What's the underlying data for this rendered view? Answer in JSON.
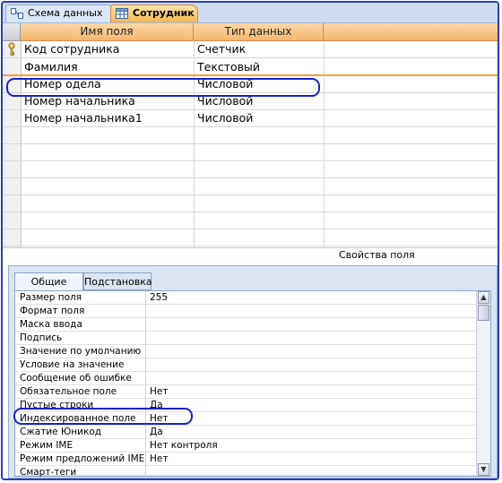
{
  "tabs": [
    {
      "label": "Схема данных",
      "icon": "relationships-icon"
    },
    {
      "label": "Сотрудник",
      "icon": "table-icon",
      "active": true
    }
  ],
  "grid": {
    "columns": [
      "Имя поля",
      "Тип данных",
      ""
    ],
    "rows": [
      {
        "name": "Код сотрудника",
        "type": "Счетчик",
        "key": true
      },
      {
        "name": "Фамилия",
        "type": "Текстовый",
        "current": true
      },
      {
        "name": "Номер одела",
        "type": "Числовой"
      },
      {
        "name": "Номер начальника",
        "type": "Числовой"
      },
      {
        "name": "Номер начальника1",
        "type": "Числовой"
      }
    ]
  },
  "properties_title": "Свойства поля",
  "property_tabs": [
    "Общие",
    "Подстановка"
  ],
  "properties": [
    {
      "label": "Размер поля",
      "value": "255"
    },
    {
      "label": "Формат поля",
      "value": ""
    },
    {
      "label": "Маска ввода",
      "value": ""
    },
    {
      "label": "Подпись",
      "value": ""
    },
    {
      "label": "Значение по умолчанию",
      "value": ""
    },
    {
      "label": "Условие на значение",
      "value": ""
    },
    {
      "label": "Сообщение об ошибке",
      "value": ""
    },
    {
      "label": "Обязательное поле",
      "value": "Нет"
    },
    {
      "label": "Пустые строки",
      "value": "Да"
    },
    {
      "label": "Индексированное поле",
      "value": "Нет"
    },
    {
      "label": "Сжатие Юникод",
      "value": "Да"
    },
    {
      "label": "Режим IME",
      "value": "Нет контроля"
    },
    {
      "label": "Режим предложений IME",
      "value": "Нет"
    },
    {
      "label": "Смарт-теги",
      "value": ""
    }
  ],
  "colors": {
    "highlight": "#1c22c9",
    "header": "#f6b56c",
    "accent_line": "#f3a345"
  }
}
